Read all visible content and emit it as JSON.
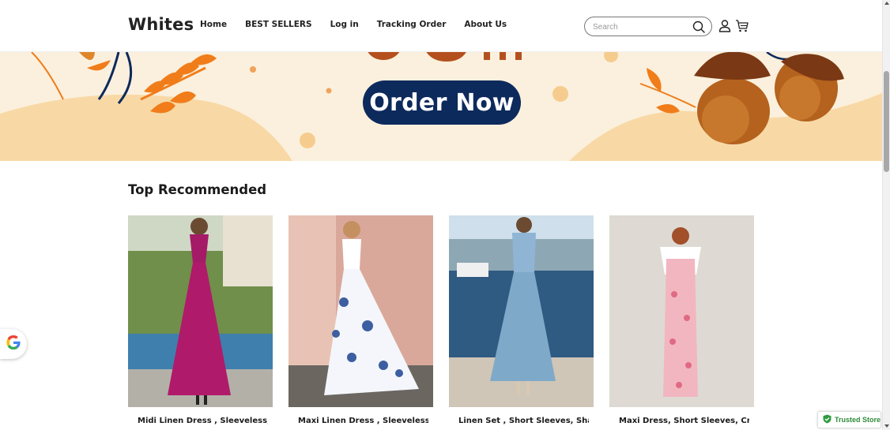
{
  "header": {
    "logo": "Whites",
    "nav": [
      {
        "label": "Home"
      },
      {
        "label": "BEST SELLERS"
      },
      {
        "label": "Log in"
      },
      {
        "label": "Tracking Order"
      },
      {
        "label": "About Us"
      }
    ],
    "search": {
      "placeholder": "Search",
      "value": ""
    },
    "icons": [
      "search-icon",
      "account-icon",
      "cart-icon"
    ]
  },
  "banner": {
    "cta_label": "Order Now",
    "colors": {
      "background": "#fbf0dd",
      "cta": "#0d2a5c",
      "leaf_orange": "#f07d1a",
      "leaf_navy": "#0d2a5c",
      "acorn": "#b4621e"
    }
  },
  "section": {
    "title": "Top Recommended",
    "products": [
      {
        "title": "Midi Linen Dress , Sleeveless,...",
        "dress_color": "#b01a6a"
      },
      {
        "title": "Maxi Linen Dress , Sleeveless,...",
        "dress_color": "#3d5ea0"
      },
      {
        "title": "Linen Set , Short Sleeves, Shawl...",
        "dress_color": "#7fa9c8"
      },
      {
        "title": "Maxi Dress, Short Sleeves, Crew...",
        "dress_color": "#e79aa8"
      }
    ]
  },
  "widgets": {
    "google_badge_icon": "google-g-icon",
    "trusted_label": "Trusted Store"
  }
}
